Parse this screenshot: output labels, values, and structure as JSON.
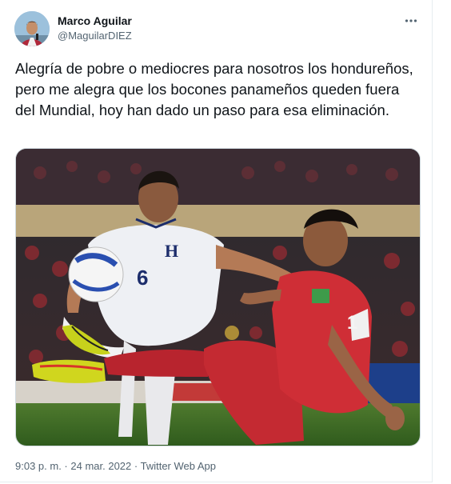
{
  "author": {
    "name": "Marco Aguilar",
    "handle": "@MaguilarDIEZ"
  },
  "tweet": {
    "text": "Alegría de pobre o mediocres para nosotros los hondureños, pero me alegra que los bocones panameños queden fuera del Mundial, hoy han dado un paso para esa eliminación."
  },
  "media": {
    "description_icons": [
      "football-match-photo"
    ],
    "jersey": {
      "honduras_letter": "H",
      "honduras_number": "6",
      "panama_number": "1"
    }
  },
  "meta": {
    "time": "9:03 p. m.",
    "separator": " · ",
    "date": "24 mar. 2022",
    "source": "Twitter Web App"
  },
  "colors": {
    "text_primary": "#0f1419",
    "text_secondary": "#536471",
    "border": "#cfd9de"
  },
  "icons": {
    "more": "more-dots-icon"
  }
}
